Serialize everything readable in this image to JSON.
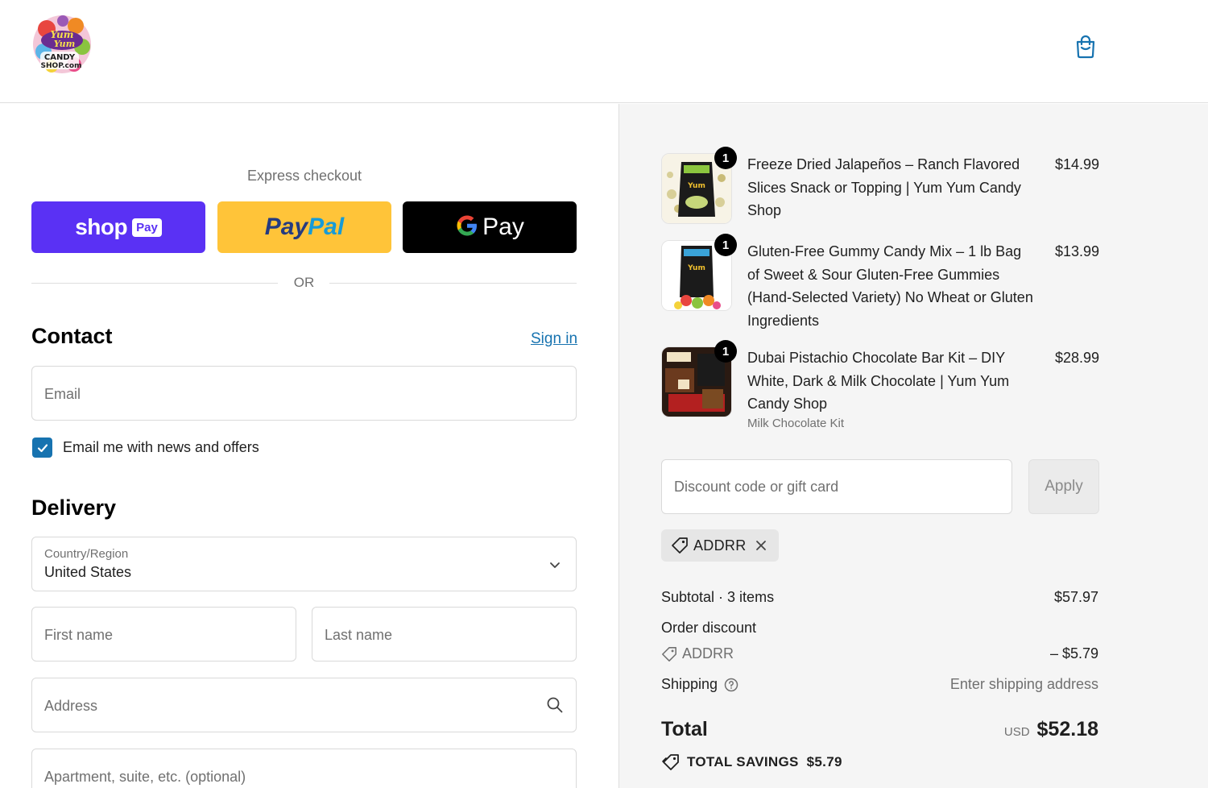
{
  "header": {
    "logo_alt": "Yum Yum Candy Shop.com",
    "cart_icon": "shopping-bag-icon"
  },
  "express": {
    "title": "Express checkout",
    "shop_label": "shop",
    "shop_pay_badge": "Pay",
    "paypal_label_1": "Pay",
    "paypal_label_2": "Pal",
    "gpay_label": "Pay",
    "or_text": "OR"
  },
  "contact": {
    "title": "Contact",
    "sign_in": "Sign in",
    "email_placeholder": "Email",
    "newsletter_label": "Email me with news and offers",
    "newsletter_checked": true
  },
  "delivery": {
    "title": "Delivery",
    "country_label": "Country/Region",
    "country_value": "United States",
    "first_name_placeholder": "First name",
    "last_name_placeholder": "Last name",
    "address_placeholder": "Address",
    "apartment_placeholder": "Apartment, suite, etc. (optional)"
  },
  "order": {
    "items": [
      {
        "title": "Freeze Dried Jalapeños – Ranch Flavored Slices Snack or Topping | Yum Yum Candy Shop",
        "quantity": "1",
        "price": "$14.99",
        "variant": ""
      },
      {
        "title": "Gluten-Free Gummy Candy Mix – 1 lb Bag of Sweet & Sour Gluten-Free Gummies (Hand-Selected Variety) No Wheat or Gluten Ingredients",
        "quantity": "1",
        "price": "$13.99",
        "variant": ""
      },
      {
        "title": "Dubai Pistachio Chocolate Bar Kit – DIY White, Dark & Milk Chocolate | Yum Yum Candy Shop",
        "quantity": "1",
        "price": "$28.99",
        "variant": "Milk Chocolate Kit"
      }
    ],
    "discount_placeholder": "Discount code or gift card",
    "apply_label": "Apply",
    "applied_code": "ADDRR",
    "subtotal_label": "Subtotal · 3 items",
    "subtotal_value": "$57.97",
    "order_discount_label": "Order discount",
    "discount_code": "ADDRR",
    "discount_value": "– $5.79",
    "shipping_label": "Shipping",
    "shipping_value": "Enter shipping address",
    "total_label": "Total",
    "currency": "USD",
    "total_value": "$52.18",
    "savings_label": "TOTAL SAVINGS",
    "savings_value": "$5.79"
  },
  "colors": {
    "shop_pay": "#5a31f4",
    "paypal": "#ffc439",
    "gpay": "#000000",
    "link": "#1773b0",
    "summary_bg": "#f5f5f5"
  }
}
